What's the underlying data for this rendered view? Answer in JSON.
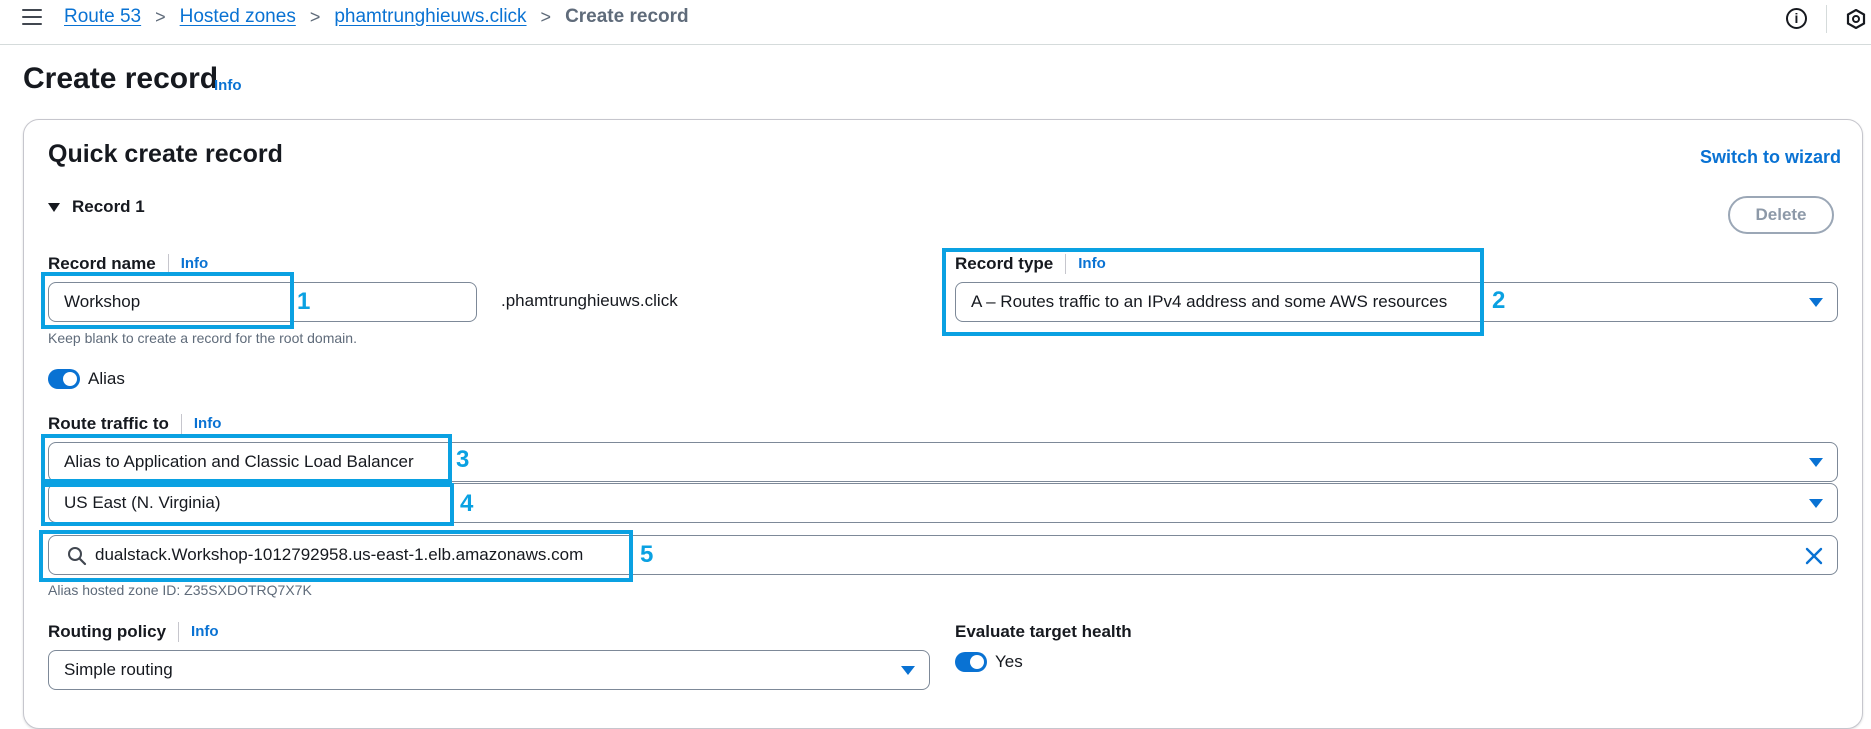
{
  "breadcrumb": {
    "items": [
      "Route 53",
      "Hosted zones",
      "phamtrunghieuws.click"
    ],
    "current": "Create record",
    "separator": ">"
  },
  "header": {
    "title": "Create record",
    "info": "Info"
  },
  "quick_create": {
    "title": "Quick create record",
    "switch_wizard": "Switch to wizard",
    "record_label": "Record 1",
    "delete_label": "Delete"
  },
  "record_name": {
    "label": "Record name",
    "info": "Info",
    "value": "Workshop",
    "suffix": ".phamtrunghieuws.click",
    "hint": "Keep blank to create a record for the root domain."
  },
  "record_type": {
    "label": "Record type",
    "info": "Info",
    "value": "A – Routes traffic to an IPv4 address and some AWS resources"
  },
  "alias": {
    "label": "Alias",
    "enabled": true
  },
  "route_traffic": {
    "label": "Route traffic to",
    "info": "Info",
    "endpoint": "Alias to Application and Classic Load Balancer",
    "region": "US East (N. Virginia)",
    "target": "dualstack.Workshop-1012792958.us-east-1.elb.amazonaws.com",
    "hosted_zone_hint": "Alias hosted zone ID: Z35SXDOTRQ7X7K"
  },
  "routing_policy": {
    "label": "Routing policy",
    "info": "Info",
    "value": "Simple routing"
  },
  "evaluate_health": {
    "label": "Evaluate target health",
    "value_label": "Yes",
    "enabled": true
  },
  "annotations": [
    "1",
    "2",
    "3",
    "4",
    "5"
  ],
  "colors": {
    "accent": "#0972d3",
    "annotation": "#0aa1e2"
  }
}
